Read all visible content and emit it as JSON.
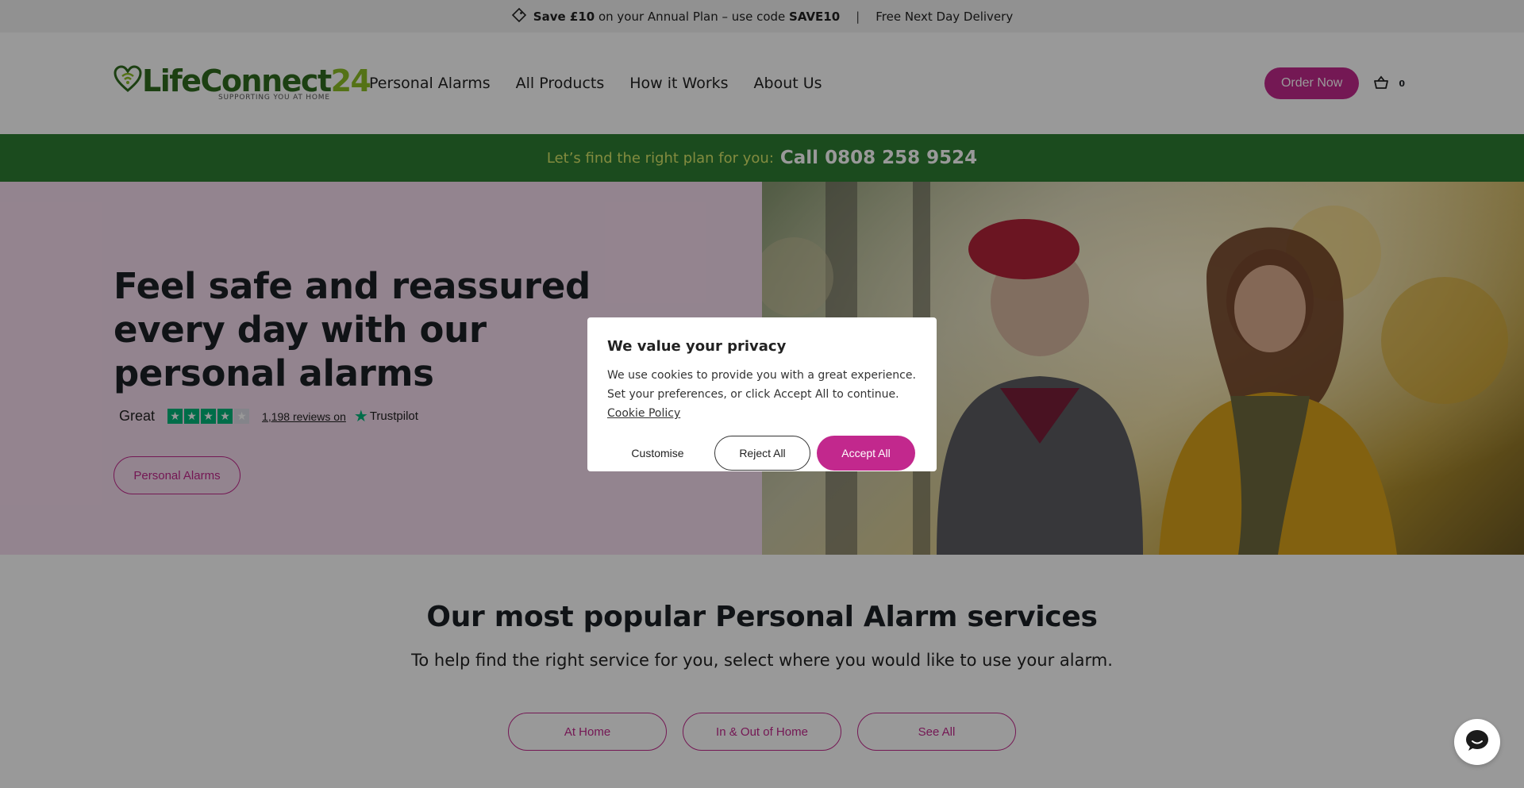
{
  "promo": {
    "save_bold": "Save £10",
    "save_mid": " on your Annual Plan – use code ",
    "code": "SAVE10",
    "separator": "|",
    "delivery": "Free Next Day Delivery"
  },
  "header": {
    "logo_life": "Life",
    "logo_connect": "Connect",
    "logo_num": "24",
    "logo_tagline": "SUPPORTING YOU AT HOME",
    "nav": [
      "Personal Alarms",
      "All Products",
      "How it Works",
      "About Us"
    ],
    "order_button": "Order Now",
    "cart_count": "0"
  },
  "callbar": {
    "lead": "Let’s find the right plan for you:",
    "phone": "Call 0808 258 9524"
  },
  "hero": {
    "title": "Feel safe and reassured every day with our personal alarms",
    "trust_rating_word": "Great",
    "trust_stars": 4.5,
    "trust_reviews": "1,198 reviews on",
    "trust_brand": "Trustpilot",
    "cta": "Personal Alarms"
  },
  "popular": {
    "heading": "Our most popular Personal Alarm services",
    "subheading": "To help find the right service for you, select where you would like to use your alarm.",
    "tabs": [
      "At Home",
      "In & Out of Home",
      "See All"
    ]
  },
  "cookie": {
    "title": "We value your privacy",
    "message": "We use cookies to provide you with a great experience. Set your preferences, or click Accept All to continue. ",
    "policy_link": "Cookie Policy",
    "customise": "Customise",
    "reject": "Reject All",
    "accept": "Accept All"
  },
  "colors": {
    "brand_magenta": "#c2288d",
    "brand_green": "#2e7d32",
    "hero_pink": "#f6dcef",
    "trustpilot_green": "#00b67a"
  },
  "icons": {
    "promo": "price-tag-icon",
    "cart": "basket-icon",
    "chat": "chat-icon",
    "trustpilot": "trustpilot-star-icon"
  }
}
